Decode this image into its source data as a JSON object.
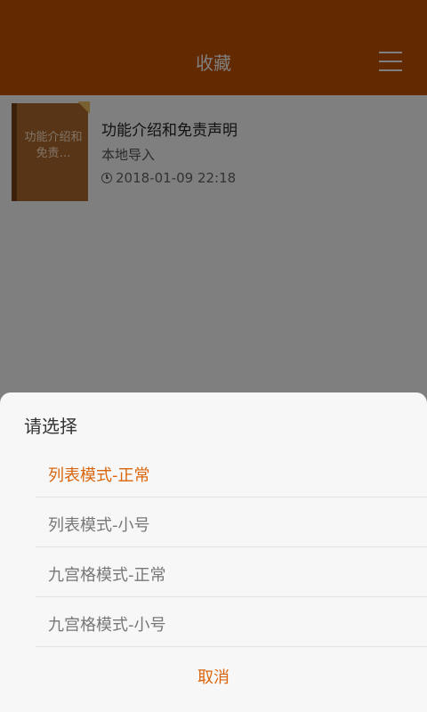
{
  "header": {
    "title": "收藏",
    "menu_icon": "hamburger-menu-icon"
  },
  "books": [
    {
      "cover_text": "功能介绍和免责…",
      "title": "功能介绍和免责声明",
      "source": "本地导入",
      "date": "2018-01-09 22:18"
    }
  ],
  "dialog": {
    "title": "请选择",
    "options": [
      {
        "label": "列表模式-正常",
        "selected": true
      },
      {
        "label": "列表模式-小号",
        "selected": false
      },
      {
        "label": "九宫格模式-正常",
        "selected": false
      },
      {
        "label": "九宫格模式-小号",
        "selected": false
      }
    ],
    "cancel_label": "取消"
  },
  "colors": {
    "brand": "#c65200",
    "accent": "#d9660c",
    "scrim": "rgba(0,0,0,0.5)"
  }
}
